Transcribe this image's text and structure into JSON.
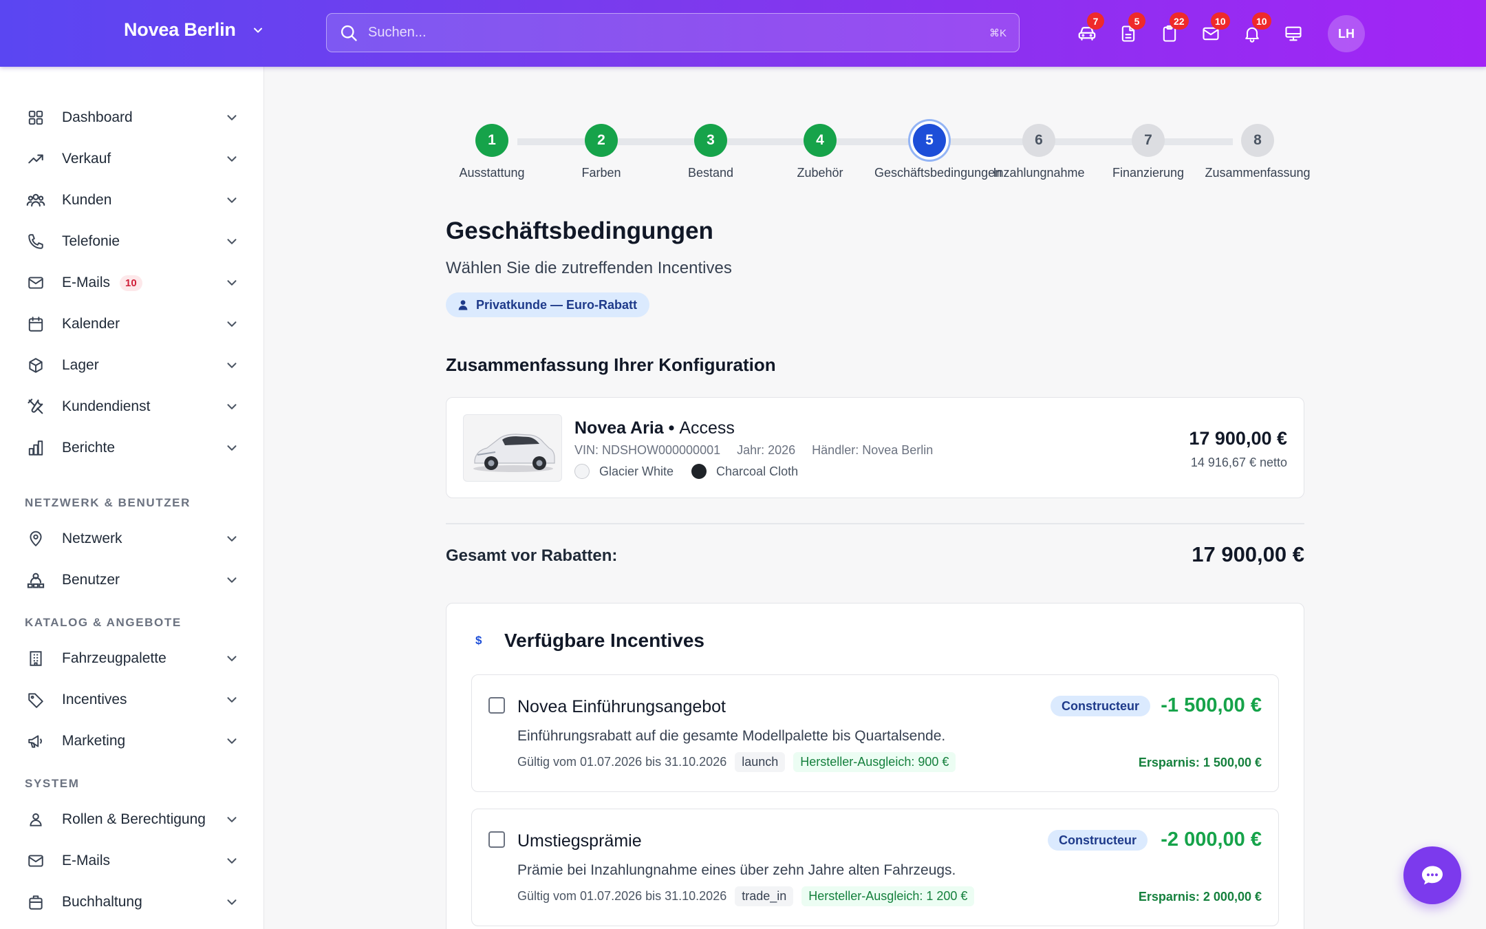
{
  "header": {
    "brand": "Novea Berlin",
    "search_placeholder": "Suchen...",
    "search_shortcut": "⌘K",
    "icons": [
      {
        "name": "car-icon",
        "badge": "7"
      },
      {
        "name": "document-icon",
        "badge": "5"
      },
      {
        "name": "clipboard-icon",
        "badge": "22"
      },
      {
        "name": "mail-icon",
        "badge": "10"
      },
      {
        "name": "bell-icon",
        "badge": "10"
      },
      {
        "name": "monitor-icon",
        "badge": ""
      }
    ],
    "avatar_initials": "LH"
  },
  "sidebar": {
    "items": [
      {
        "label": "Dashboard",
        "icon": "grid-icon"
      },
      {
        "label": "Verkauf",
        "icon": "trend-icon"
      },
      {
        "label": "Kunden",
        "icon": "users-icon"
      },
      {
        "label": "Telefonie",
        "icon": "phone-icon"
      },
      {
        "label": "E-Mails",
        "icon": "mail-icon",
        "badge": "10"
      },
      {
        "label": "Kalender",
        "icon": "calendar-icon"
      },
      {
        "label": "Lager",
        "icon": "box-icon"
      },
      {
        "label": "Kundendienst",
        "icon": "tools-icon"
      },
      {
        "label": "Berichte",
        "icon": "chart-icon"
      }
    ],
    "section_network": "NETZWERK & BENUTZER",
    "network_items": [
      {
        "label": "Netzwerk",
        "icon": "location-icon"
      },
      {
        "label": "Benutzer",
        "icon": "user-network-icon"
      }
    ],
    "section_catalog": "KATALOG & ANGEBOTE",
    "catalog_items": [
      {
        "label": "Fahrzeugpalette",
        "icon": "building-icon"
      },
      {
        "label": "Incentives",
        "icon": "tag-icon"
      },
      {
        "label": "Marketing",
        "icon": "megaphone-icon"
      }
    ],
    "section_system": "SYSTEM",
    "system_items": [
      {
        "label": "Rollen & Berechtigung",
        "icon": "user-icon"
      },
      {
        "label": "E-Mails",
        "icon": "mail-icon"
      },
      {
        "label": "Buchhaltung",
        "icon": "briefcase-icon"
      }
    ]
  },
  "stepper": {
    "steps": [
      {
        "num": "1",
        "label": "Ausstattung",
        "state": "done"
      },
      {
        "num": "2",
        "label": "Farben",
        "state": "done"
      },
      {
        "num": "3",
        "label": "Bestand",
        "state": "done"
      },
      {
        "num": "4",
        "label": "Zubehör",
        "state": "done"
      },
      {
        "num": "5",
        "label": "Geschäftsbedingungen",
        "state": "active"
      },
      {
        "num": "6",
        "label": "Inzahlungnahme",
        "state": "todo"
      },
      {
        "num": "7",
        "label": "Finanzierung",
        "state": "todo"
      },
      {
        "num": "8",
        "label": "Zusammenfassung",
        "state": "todo"
      }
    ]
  },
  "main": {
    "title": "Geschäftsbedingungen",
    "subtitle": "Wählen Sie die zutreffenden Incentives",
    "customer_chip": "Privatkunde — Euro-Rabatt",
    "config_title": "Zusammenfassung Ihrer Konfiguration",
    "vehicle": {
      "model": "Novea Aria",
      "separator": " • ",
      "trim": "Access",
      "vin": "VIN: NDSHOW000000001",
      "year": "Jahr: 2026",
      "dealer": "Händler: Novea Berlin",
      "exterior_color": "Glacier White",
      "exterior_hex": "#f3f4f6",
      "interior_color": "Charcoal Cloth",
      "interior_hex": "#1f2328",
      "price": "17 900,00 €",
      "price_net": "14 916,67 € netto"
    },
    "total_label": "Gesamt vor Rabatten:",
    "total_value": "17 900,00 €",
    "incentives_title": "Verfügbare Incentives",
    "incentives_icon": "$",
    "incentives": [
      {
        "title": "Novea Einführungsangebot",
        "description": "Einführungsrabatt auf die gesamte Modellpalette bis Quartalsende.",
        "validity": "Gültig vom 01.07.2026 bis 31.10.2026",
        "tag": "launch",
        "compensation": "Hersteller-Ausgleich: 900 €",
        "source": "Constructeur",
        "amount": "-1 500,00 €",
        "saving": "Ersparnis: 1 500,00 €"
      },
      {
        "title": "Umstiegsprämie",
        "description": "Prämie bei Inzahlungnahme eines über zehn Jahre alten Fahrzeugs.",
        "validity": "Gültig vom 01.07.2026 bis 31.10.2026",
        "tag": "trade_in",
        "compensation": "Hersteller-Ausgleich: 1 200 €",
        "source": "Constructeur",
        "amount": "-2 000,00 €",
        "saving": "Ersparnis: 2 000,00 €"
      }
    ]
  },
  "colors": {
    "header_gradient_start": "#5a46f2",
    "header_gradient_end": "#a324f5",
    "step_done": "#16a34a",
    "step_active": "#1d4ed8",
    "discount": "#16a34a",
    "badge_red": "#ef2a2a"
  }
}
